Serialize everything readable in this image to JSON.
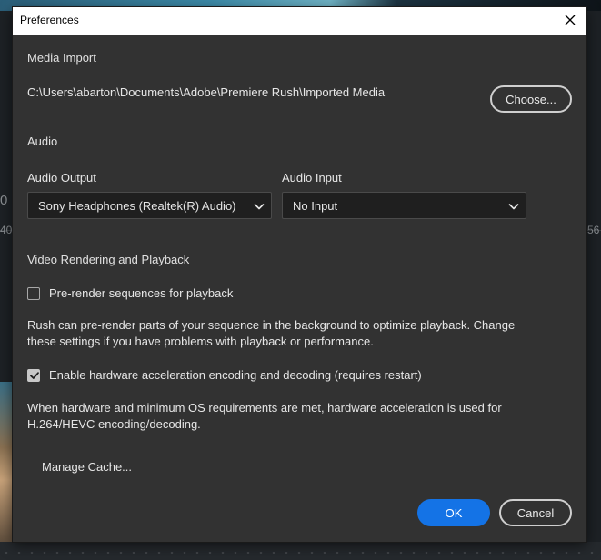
{
  "background": {
    "left_number": "40",
    "left_number_top": "0",
    "right_number": "56"
  },
  "dialog": {
    "title": "Preferences",
    "close_icon": "close-icon"
  },
  "media_import": {
    "heading": "Media Import",
    "path": "C:\\Users\\abarton\\Documents\\Adobe\\Premiere Rush\\Imported Media",
    "choose_label": "Choose..."
  },
  "audio": {
    "heading": "Audio",
    "output_label": "Audio Output",
    "output_value": "Sony Headphones (Realtek(R) Audio)",
    "input_label": "Audio Input",
    "input_value": "No Input"
  },
  "video": {
    "heading": "Video Rendering and Playback",
    "prerender_label": "Pre-render sequences for playback",
    "prerender_checked": false,
    "prerender_desc": "Rush can pre-render parts of your sequence in the background to optimize playback. Change these settings if you have problems with playback or performance.",
    "hw_label": "Enable hardware acceleration encoding and decoding (requires restart)",
    "hw_checked": true,
    "hw_desc": "When hardware and minimum OS requirements are met, hardware acceleration is used for H.264/HEVC encoding/decoding.",
    "manage_cache_label": "Manage Cache..."
  },
  "footer": {
    "ok_label": "OK",
    "cancel_label": "Cancel"
  },
  "colors": {
    "dialog_bg": "#323232",
    "accent": "#1473e6",
    "text": "#e6e6e6"
  }
}
